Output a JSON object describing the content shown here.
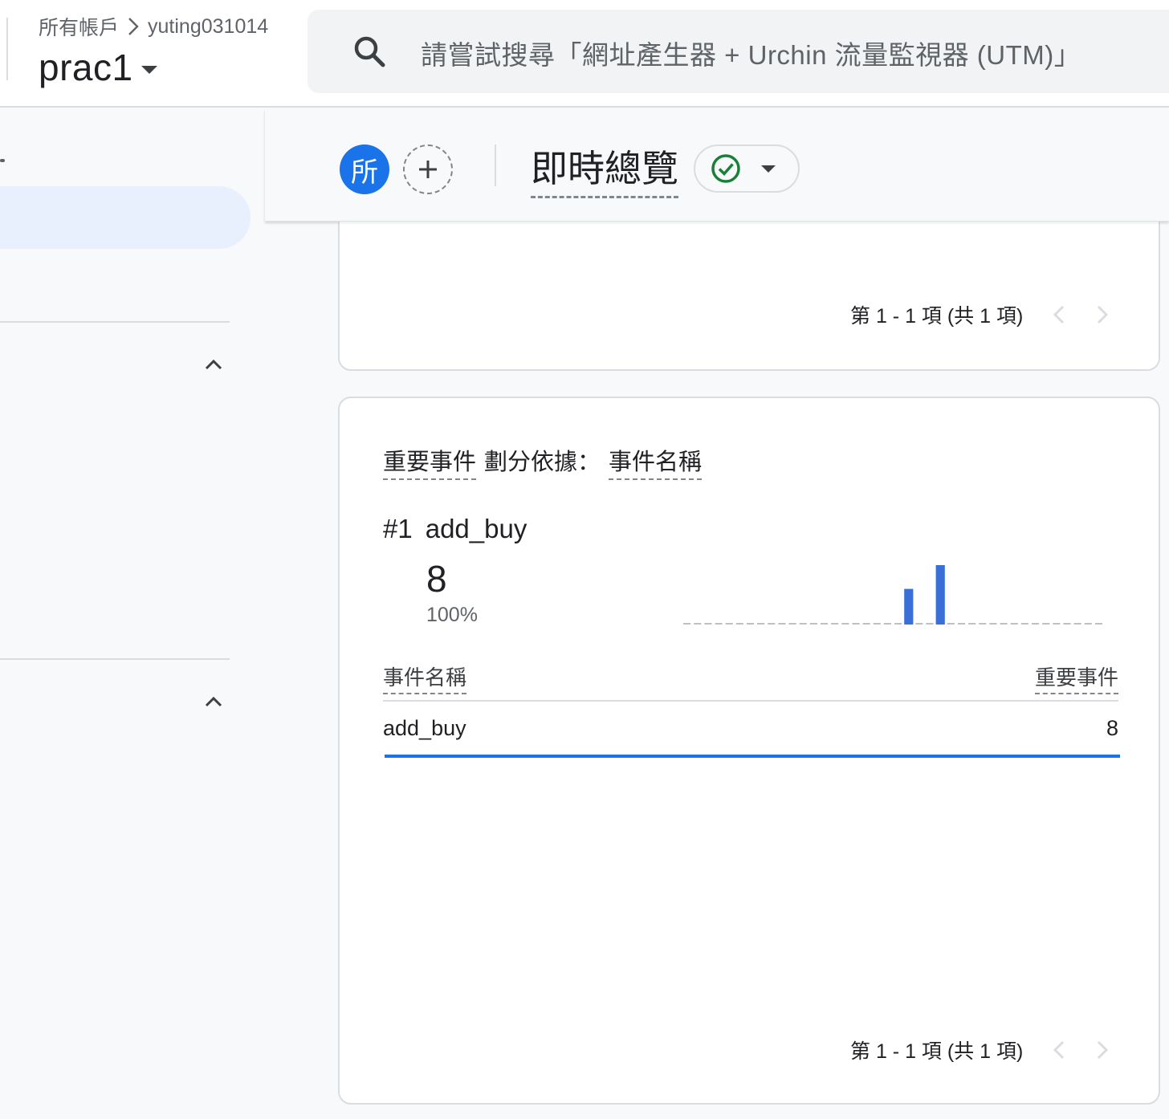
{
  "topbar": {
    "breadcrumb_root": "所有帳戶",
    "breadcrumb_account": "yuting031014",
    "property_name": "prac1",
    "search_placeholder": "請嘗試搜尋「網址產生器 + Urchin 流量監視器 (UTM)」"
  },
  "subheader": {
    "avatar_label": "所",
    "report_title": "即時總覽",
    "status_icon": "check-circle-icon",
    "status_color": "#188038"
  },
  "card_top": {
    "pagination": "第 1 - 1 項 (共 1 項)"
  },
  "key_events_card": {
    "title_metric": "重要事件",
    "title_breakdown_label": "劃分依據：",
    "title_dimension": "事件名稱",
    "top_rank": "#1",
    "top_name": "add_buy",
    "top_value": "8",
    "top_percent": "100%",
    "table": {
      "columns": [
        "事件名稱",
        "重要事件"
      ],
      "rows": [
        {
          "name": "add_buy",
          "value": "8",
          "share": 1.0
        }
      ]
    },
    "pagination": "第 1 - 1 項 (共 1 項)"
  },
  "sparkline": {
    "color": "#3b6fd8",
    "values": [
      0,
      0,
      0,
      0,
      0,
      0,
      0,
      0,
      0,
      0,
      0,
      0,
      0,
      0,
      0,
      0,
      0,
      0,
      0,
      0,
      0,
      3,
      0,
      0,
      5,
      0,
      0,
      0,
      0,
      0,
      0,
      0,
      0,
      0,
      0,
      0,
      0,
      0,
      0,
      0
    ]
  }
}
